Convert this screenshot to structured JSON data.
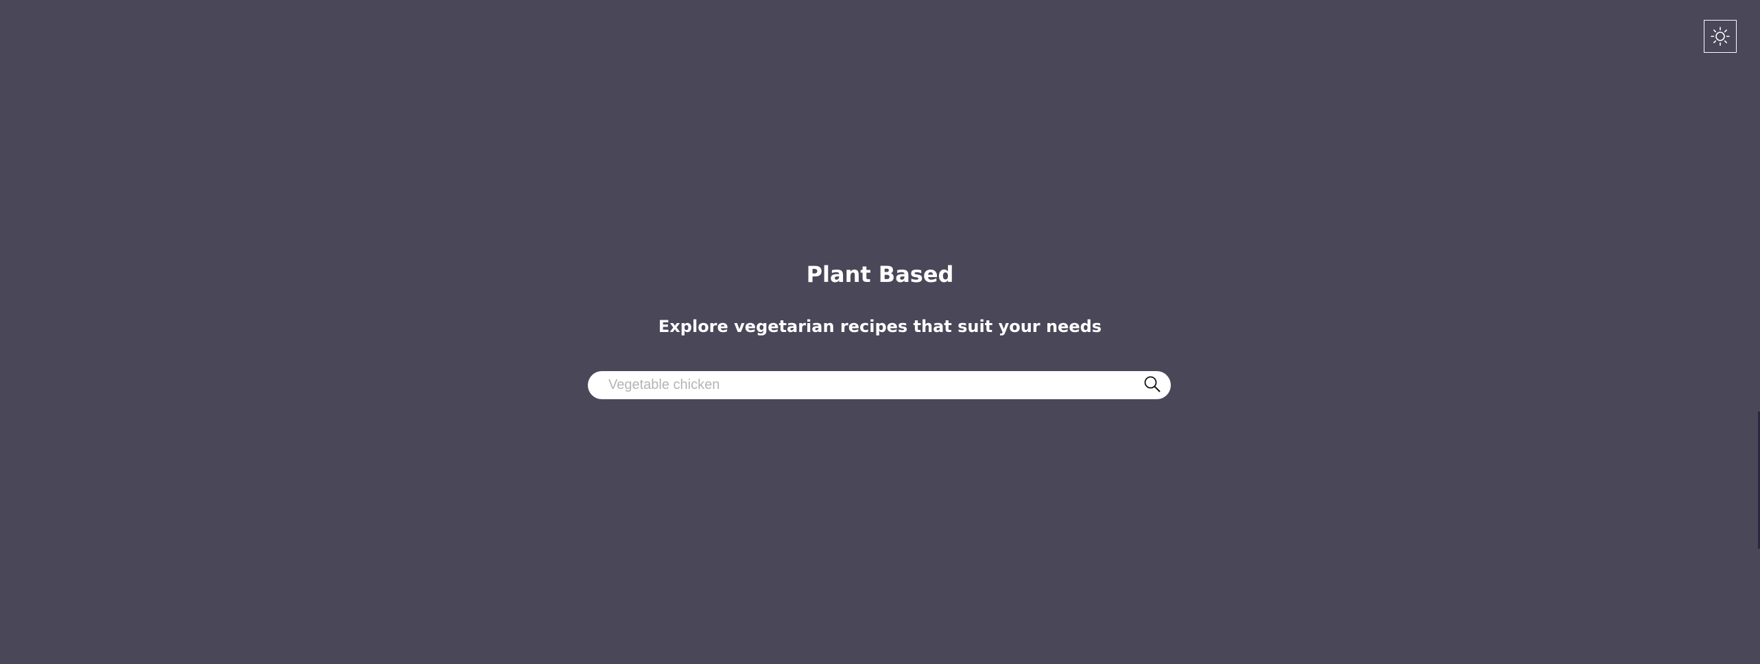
{
  "app": {
    "title": "Plant Based",
    "subtitle": "Explore vegetarian recipes that suit your needs"
  },
  "search": {
    "placeholder": "Vegetable chicken",
    "value": "",
    "icon": "search-icon"
  },
  "theme_toggle": {
    "icon": "sun-icon"
  },
  "colors": {
    "background": "#4a4759",
    "text": "#ffffff",
    "search_background": "#ffffff",
    "placeholder": "#b4b4b4"
  }
}
